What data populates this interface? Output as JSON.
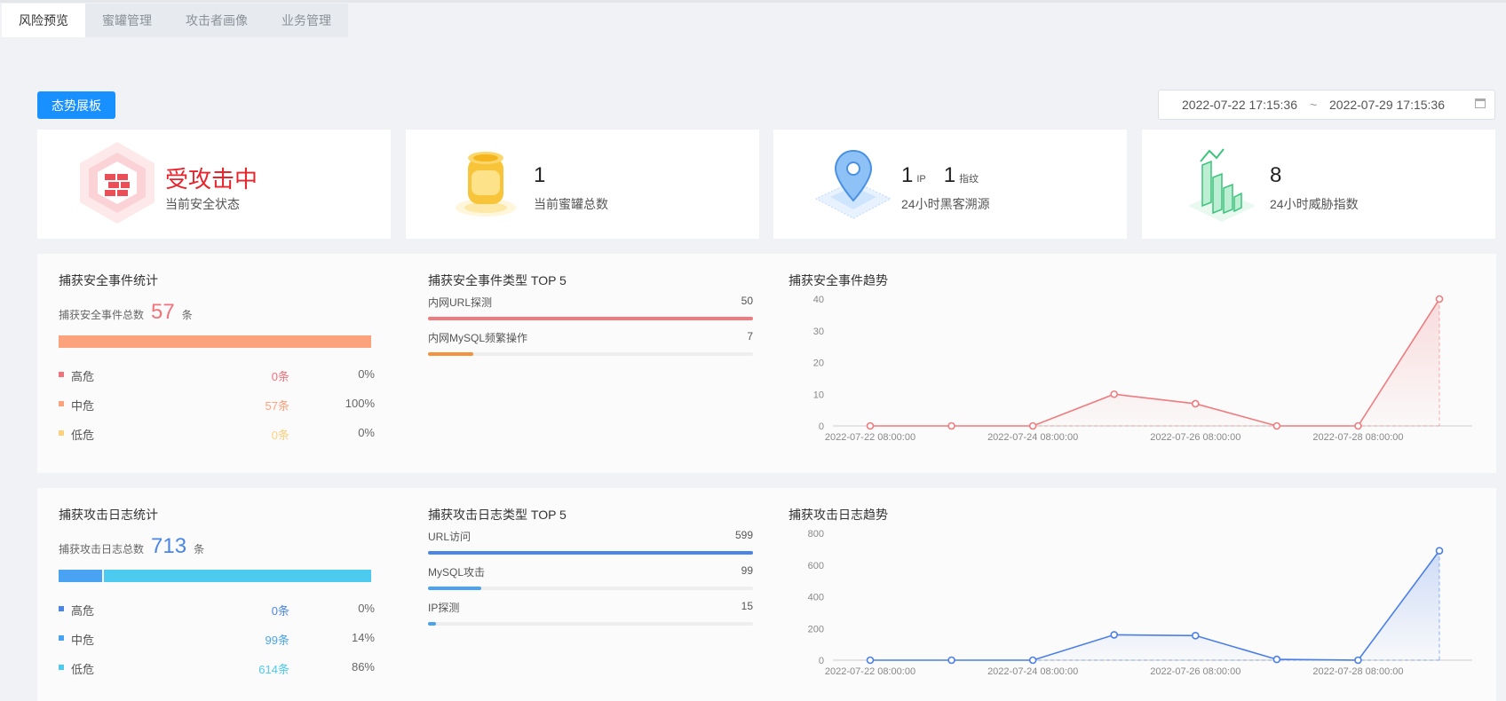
{
  "tabs": [
    "风险预览",
    "蜜罐管理",
    "攻击者画像",
    "业务管理"
  ],
  "toolbar": {
    "dashboard_button": "态势展板",
    "date_start": "2022-07-22 17:15:36",
    "date_sep": "~",
    "date_end": "2022-07-29 17:15:36"
  },
  "cards": {
    "status": {
      "value": "受攻击中",
      "label": "当前安全状态"
    },
    "honeypot": {
      "value": "1",
      "label": "当前蜜罐总数"
    },
    "trace": {
      "ip_value": "1",
      "ip_unit": "IP",
      "fp_value": "1",
      "fp_unit": "指纹",
      "label": "24小时黑客溯源"
    },
    "threat": {
      "value": "8",
      "label": "24小时威胁指数"
    }
  },
  "events": {
    "stats_title": "捕获安全事件统计",
    "total_label": "捕获安全事件总数",
    "total": "57",
    "total_unit": "条",
    "levels": [
      {
        "name": "高危",
        "count": "0条",
        "pct": "0%",
        "color": "#f2727c",
        "fraction": 0
      },
      {
        "name": "中危",
        "count": "57条",
        "pct": "100%",
        "color": "#fca27c",
        "fraction": 1.0
      },
      {
        "name": "低危",
        "count": "0条",
        "pct": "0%",
        "color": "#fcd07c",
        "fraction": 0
      }
    ],
    "top5_title": "捕获安全事件类型 TOP 5",
    "top5": [
      {
        "label": "内网URL探测",
        "value": "50",
        "fraction": 1.0,
        "color": "#f07a7e"
      },
      {
        "label": "内网MySQL频繁操作",
        "value": "7",
        "fraction": 0.14,
        "color": "#f5923e"
      }
    ],
    "trend_title": "捕获安全事件趋势"
  },
  "logs": {
    "stats_title": "捕获攻击日志统计",
    "total_label": "捕获攻击日志总数",
    "total": "713",
    "total_unit": "条",
    "levels": [
      {
        "name": "高危",
        "count": "0条",
        "pct": "0%",
        "color": "#4a86e8",
        "fraction": 0
      },
      {
        "name": "中危",
        "count": "99条",
        "pct": "14%",
        "color": "#4aa3f2",
        "fraction": 0.14
      },
      {
        "name": "低危",
        "count": "614条",
        "pct": "86%",
        "color": "#4ccaf0",
        "fraction": 0.86
      }
    ],
    "top5_title": "捕获攻击日志类型 TOP 5",
    "top5": [
      {
        "label": "URL访问",
        "value": "599",
        "fraction": 1.0,
        "color": "#4a86e8"
      },
      {
        "label": "MySQL攻击",
        "value": "99",
        "fraction": 0.165,
        "color": "#4aa3f2"
      },
      {
        "label": "IP探测",
        "value": "15",
        "fraction": 0.025,
        "color": "#4aa3f2"
      }
    ],
    "trend_title": "捕获攻击日志趋势"
  },
  "chart_data": [
    {
      "type": "area",
      "title": "捕获安全事件趋势",
      "x": [
        "2022-07-22 08:00:00",
        "2022-07-23 08:00:00",
        "2022-07-24 08:00:00",
        "2022-07-25 08:00:00",
        "2022-07-26 08:00:00",
        "2022-07-27 08:00:00",
        "2022-07-28 08:00:00",
        "2022-07-29 08:00:00"
      ],
      "x_tick_labels": [
        "2022-07-22 08:00:00",
        "2022-07-24 08:00:00",
        "2022-07-26 08:00:00",
        "2022-07-28 08:00:00"
      ],
      "values": [
        0,
        0,
        0,
        10,
        7,
        0,
        0,
        40
      ],
      "yticks": [
        0,
        10,
        20,
        30,
        40
      ],
      "ylim": [
        0,
        40
      ],
      "color": "#f07a7e"
    },
    {
      "type": "area",
      "title": "捕获攻击日志趋势",
      "x": [
        "2022-07-22 08:00:00",
        "2022-07-23 08:00:00",
        "2022-07-24 08:00:00",
        "2022-07-25 08:00:00",
        "2022-07-26 08:00:00",
        "2022-07-27 08:00:00",
        "2022-07-28 08:00:00",
        "2022-07-29 08:00:00"
      ],
      "x_tick_labels": [
        "2022-07-22 08:00:00",
        "2022-07-24 08:00:00",
        "2022-07-26 08:00:00",
        "2022-07-28 08:00:00"
      ],
      "values": [
        0,
        0,
        0,
        160,
        155,
        5,
        0,
        690
      ],
      "yticks": [
        0,
        200,
        400,
        600,
        800
      ],
      "ylim": [
        0,
        800
      ],
      "color": "#4a7ee8"
    }
  ]
}
